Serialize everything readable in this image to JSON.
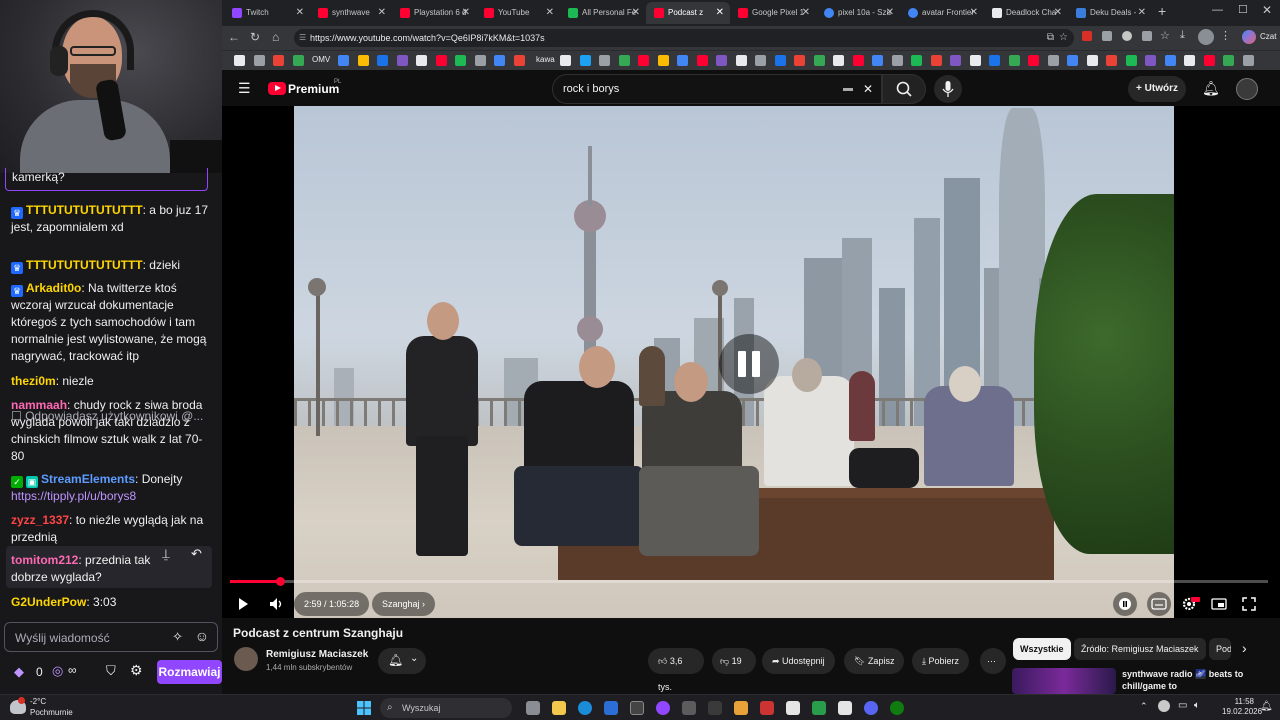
{
  "chat": {
    "prev_text": "kamerką?",
    "messages": [
      {
        "user": "TTTUTUTUTUTUTTT",
        "color": "#ffd700",
        "text": ": a bo juz 17 jest, zapomnialem xd"
      },
      {
        "user": "TTTUTUTUTUTUTTT",
        "color": "#ffd700",
        "text": ": dzieki"
      },
      {
        "user": "Arkadit0o",
        "color": "#ffd700",
        "text": ": Na twitterze ktoś wczoraj wrzucał dokumentacje któregoś z tych samochodów i tam normalnie jest wylistowane, że mogą nagrywać, trackować itp"
      },
      {
        "user": "thezi0m",
        "color": "#ff69b4",
        "text": ": niezle"
      },
      {
        "user": "nammaah",
        "color": "#ff69b4",
        "text": ": chudy rock z siwa broda wyglada powoli jak taki dziadzio z chinskich filmow sztuk walk z lat 70-80"
      },
      {
        "user": "StreamElements",
        "color": "#5c9cff",
        "text": ": Donejty "
      },
      {
        "user": "zyzz_1337",
        "color": "#ff4545",
        "text": ": to nieźle wyglądą jak na przednią"
      },
      {
        "user": "tomitom212",
        "color": "#ff69b4",
        "text": ": przednia tak dobrze wyglada?"
      },
      {
        "user": "G2UnderPow",
        "color": "#ffd700",
        "text": ": 3:03"
      }
    ],
    "reply_text": "Odpowiadasz użytkownikowi @...",
    "donate_link": "https://tipply.pl/u/borys8",
    "input_placeholder": "Wyślij wiadomość",
    "points": "0",
    "send_button": "Rozmawiaj"
  },
  "browser": {
    "tabs": [
      {
        "label": "Twitch",
        "color": "#9147ff"
      },
      {
        "label": "synthwave",
        "color": "#ff0033"
      },
      {
        "label": "Playstation 6 d",
        "color": "#ff0033"
      },
      {
        "label": "YouTube",
        "color": "#ff0033"
      },
      {
        "label": "All Personal Fe",
        "color": "#1db954"
      },
      {
        "label": "Podcast z",
        "color": "#ff0033"
      },
      {
        "label": "Google Pixel 1",
        "color": "#ff0033"
      },
      {
        "label": "pixel 10a - Szu",
        "color": "#4285f4"
      },
      {
        "label": "avatar Frontier",
        "color": "#4285f4"
      },
      {
        "label": "Deadlock Cha",
        "color": "#e8eaed"
      },
      {
        "label": "Deku Deals - ",
        "color": "#3b7ddd"
      }
    ],
    "url": "https://www.youtube.com/watch?v=Qe6IP8i7kKM&t=1037s",
    "bookmark_labels": [
      "OMV",
      "kawa"
    ]
  },
  "youtube": {
    "brand": "Premium",
    "region": "PL",
    "search_query": "rock i borys",
    "create_label": "Utwórz",
    "time_current": "2:59",
    "time_total": "1:05:28",
    "chapter": "Szanghaj",
    "progress_fraction": 0.048,
    "video_title": "Podcast z centrum Szanghaju",
    "channel_name": "Remigiusz Maciaszek",
    "channel_subs": "1,44 mln subskrybentów",
    "likes": "3,6 tys.",
    "dislikes": "19",
    "share": "Udostępnij",
    "save": "Zapisz",
    "download": "Pobierz",
    "chips": [
      "Wszystkie",
      "Źródło: Remigiusz Maciaszek",
      "Pod"
    ],
    "rec_title": "synthwave radio 🌌 beats to chill/game to"
  },
  "taskbar": {
    "weather_temp": "-2°C",
    "weather_desc": "Pochmurnie",
    "search_label": "Wyszukaj",
    "time": "11:58",
    "date": "19.02.2026",
    "tray_lang": "Czat"
  }
}
